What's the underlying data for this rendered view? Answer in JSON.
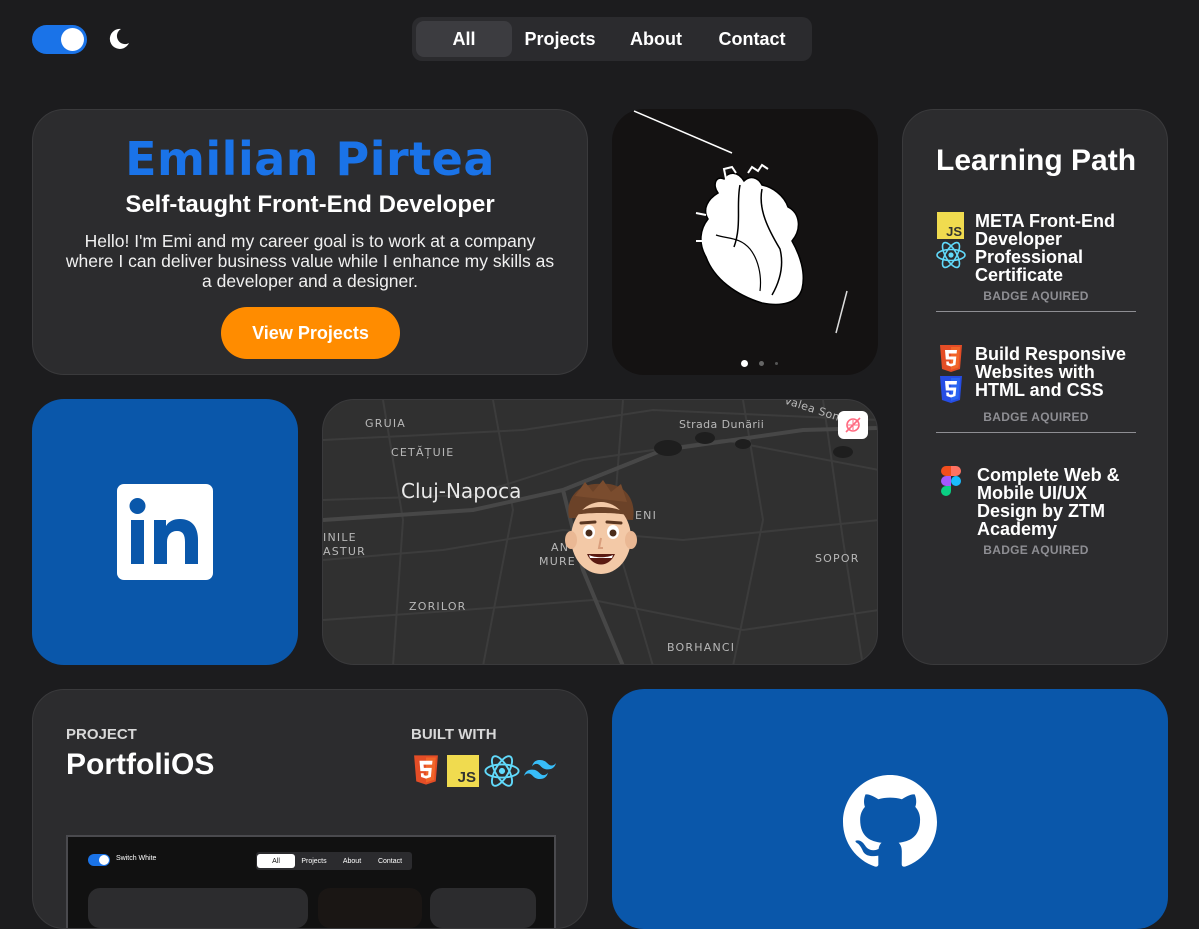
{
  "header": {
    "theme_toggle": "on",
    "nav": [
      {
        "label": "All",
        "active": true
      },
      {
        "label": "Projects",
        "active": false
      },
      {
        "label": "About",
        "active": false
      },
      {
        "label": "Contact",
        "active": false
      }
    ]
  },
  "intro": {
    "name": "Emilian Pirtea",
    "title": "Self-taught Front-End Developer",
    "bio": "Hello! I'm Emi and my career goal is to work at a company where I can deliver business value while I enhance my skills as a developer and a designer.",
    "cta": "View Projects"
  },
  "art": {
    "slides_total": 3,
    "active_slide": 1
  },
  "learning": {
    "heading": "Learning Path",
    "courses": [
      {
        "title": "META Front-End Developer Professional Certificate",
        "status": "BADGE AQUIRED",
        "icons": [
          "javascript-icon",
          "react-icon"
        ]
      },
      {
        "title": "Build Responsive Websites with HTML and CSS",
        "status": "BADGE AQUIRED",
        "icons": [
          "html5-icon",
          "css3-icon"
        ]
      },
      {
        "title": "Complete Web & Mobile UI/UX Design by ZTM Academy",
        "status": "BADGE AQUIRED",
        "icons": [
          "figma-icon"
        ]
      }
    ]
  },
  "linkedin": {
    "icon": "linkedin-icon"
  },
  "map": {
    "city": "Cluj-Napoca",
    "labels": [
      "GRUIA",
      "CETĂȚUIE",
      "Strada Dunării",
      "Valea Some",
      "ENI",
      "INILE",
      "ASTUR",
      "AN",
      "MURE",
      "ZORILOR",
      "SOPOR",
      "BORHANCI"
    ]
  },
  "project": {
    "kicker": "PROJECT",
    "name": "PortfoliOS",
    "built_with": "BUILT WITH",
    "stack": [
      "html5-icon",
      "javascript-icon",
      "react-icon",
      "tailwind-icon"
    ],
    "preview": {
      "toggle_label": "Switch White",
      "nav": [
        "All",
        "Projects",
        "About",
        "Contact"
      ]
    }
  },
  "github": {
    "icon": "github-icon"
  },
  "colors": {
    "accent_blue": "#1a73e8",
    "orange": "#ff8c00",
    "card_blue": "#0a57aa",
    "bg": "#1c1c1e",
    "card": "#2c2c2e"
  }
}
